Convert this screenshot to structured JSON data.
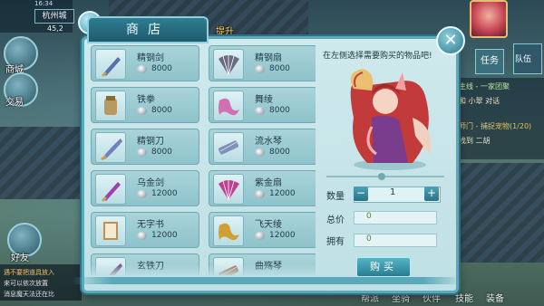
{
  "hud": {
    "location": "杭州城",
    "time": "16:34",
    "coord": "45,2",
    "left_buttons": [
      "商城",
      "交易",
      "好友"
    ],
    "top_center_label": "提升",
    "task_label": "任务",
    "team_label": "队伍"
  },
  "quests": [
    {
      "text": "主线 - 一家团聚",
      "color": "#b8e6a0"
    },
    {
      "text": "和 小翠 对话",
      "color": "#e8e0c0"
    },
    {
      "text": "师门 - 捕捉宠物(1/20)",
      "color": "#e4c060"
    },
    {
      "text": "找到 二胡",
      "color": "#e8e0c0"
    }
  ],
  "chat": [
    "遇不要把道具放入",
    "来可以依次放置",
    "消息魔天法还在比"
  ],
  "bottom_bar": [
    "帮派",
    "坐骑",
    "伙伴",
    "技能",
    "装备"
  ],
  "shop": {
    "title": "商店",
    "close_glyph": "✕",
    "hint": "在左侧选择需要购买的物品吧!",
    "items": [
      {
        "name": "精钢剑",
        "price": "8000",
        "icon": "sword-icon",
        "color": "#5a6fb0"
      },
      {
        "name": "精钢扇",
        "price": "8000",
        "icon": "fan-icon",
        "color": "#6a6a80"
      },
      {
        "name": "铁拳",
        "price": "8000",
        "icon": "gauntlet-icon",
        "color": "#b89a60"
      },
      {
        "name": "舞绫",
        "price": "8000",
        "icon": "ribbon-icon",
        "color": "#d070b0"
      },
      {
        "name": "精钢刀",
        "price": "8000",
        "icon": "blade-icon",
        "color": "#7080c0"
      },
      {
        "name": "流水琴",
        "price": "8000",
        "icon": "zither-icon",
        "color": "#8090b8"
      },
      {
        "name": "乌金剑",
        "price": "12000",
        "icon": "sword-icon",
        "color": "#a040b0"
      },
      {
        "name": "紫金扇",
        "price": "12000",
        "icon": "fan-icon",
        "color": "#c04090"
      },
      {
        "name": "无字书",
        "price": "12000",
        "icon": "book-icon",
        "color": "#c09050"
      },
      {
        "name": "飞天绫",
        "price": "12000",
        "icon": "ribbon-icon",
        "color": "#d0a030"
      },
      {
        "name": "玄铁刀",
        "price": "",
        "icon": "blade-icon",
        "color": "#7a5080"
      },
      {
        "name": "曲殇琴",
        "price": "",
        "icon": "zither-icon",
        "color": "#a07050"
      }
    ],
    "quantity_label": "数量",
    "quantity": "1",
    "total_label": "总价",
    "total": "0",
    "owned_label": "拥有",
    "owned": "0",
    "buy_label": "购买",
    "minus_glyph": "−",
    "plus_glyph": "+"
  }
}
